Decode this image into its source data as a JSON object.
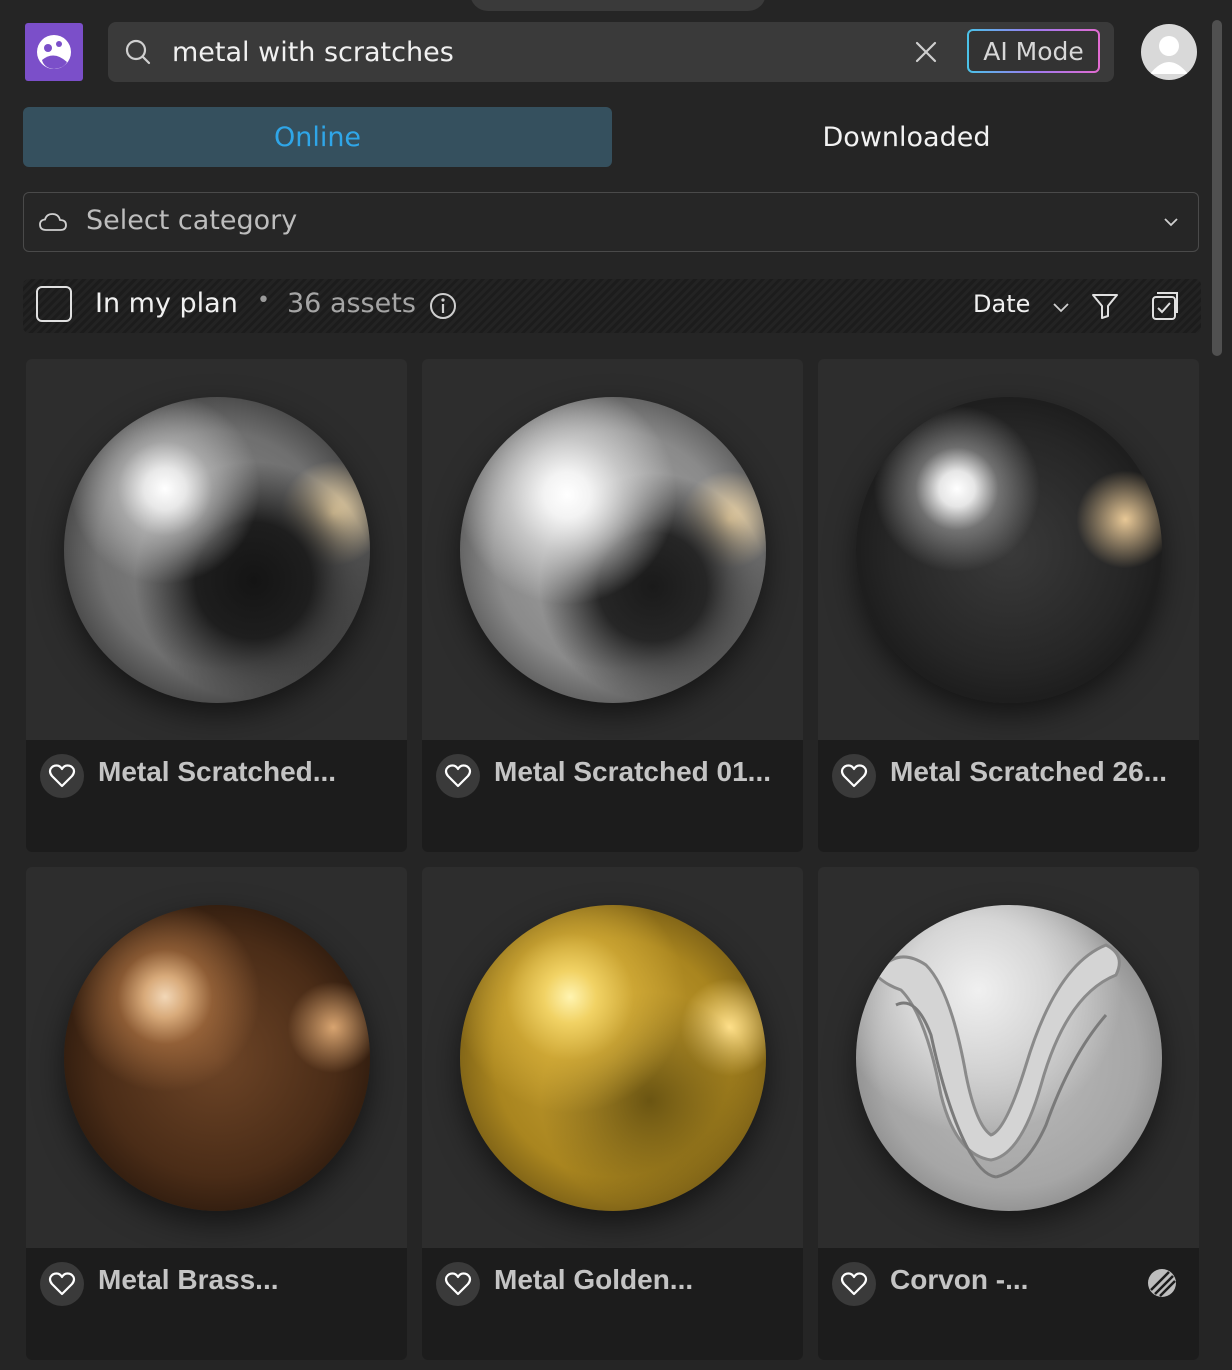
{
  "search": {
    "query": "metal with scratches",
    "ai_mode_label": "AI Mode"
  },
  "tabs": [
    {
      "label": "Online",
      "active": true
    },
    {
      "label": "Downloaded",
      "active": false
    }
  ],
  "category": {
    "placeholder": "Select category"
  },
  "plan_bar": {
    "label": "In my plan",
    "separator": "•",
    "asset_count": "36 assets",
    "sort_label": "Date"
  },
  "assets": [
    {
      "title": "Metal Scratched...",
      "material": "worn steel"
    },
    {
      "title": "Metal Scratched 01...",
      "material": "brushed silver"
    },
    {
      "title": "Metal Scratched 26...",
      "material": "dark chrome"
    },
    {
      "title": "Metal Brass...",
      "material": "brass"
    },
    {
      "title": "Metal Golden...",
      "material": "gold"
    },
    {
      "title": "Corvon -...",
      "material": "grey matte"
    }
  ],
  "colors": {
    "accent": "#2fa6e8",
    "logo_bg": "#7b4fc9",
    "background": "#252525",
    "card_bg": "#2d2d2d",
    "card_footer": "#1c1c1c"
  },
  "icons": {
    "logo": "app-logo-icon",
    "search": "search-icon",
    "clear": "close-icon",
    "avatar": "user-avatar-icon",
    "category": "cloud-icon",
    "dropdown": "chevron-down-icon",
    "info": "info-icon",
    "filter": "filter-icon",
    "select": "select-all-icon",
    "favorite": "heart-icon"
  }
}
